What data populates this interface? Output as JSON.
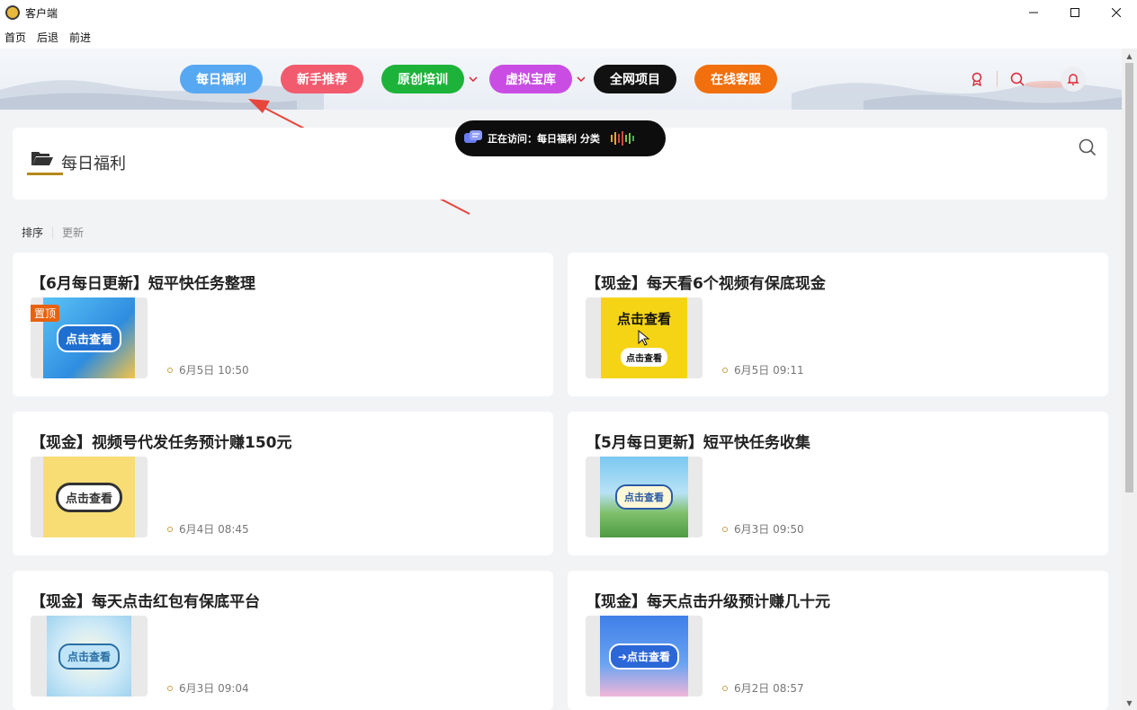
{
  "window": {
    "title": "客户端"
  },
  "menu": {
    "items": [
      "首页",
      "后退",
      "前进"
    ]
  },
  "nav": {
    "items": [
      {
        "label": "每日福利",
        "color": "#57a8f2",
        "dropdown": false
      },
      {
        "label": "新手推荐",
        "color": "#f25a6e",
        "dropdown": false
      },
      {
        "label": "原创培训",
        "color": "#1db33a",
        "dropdown": true
      },
      {
        "label": "虚拟宝库",
        "color": "#c94de3",
        "dropdown": true
      },
      {
        "label": "全网项目",
        "color": "#111111",
        "dropdown": false
      },
      {
        "label": "在线客服",
        "color": "#f26f0d",
        "dropdown": false
      }
    ]
  },
  "visiting": {
    "text": "正在访问：每日福利 分类"
  },
  "category": {
    "title": "每日福利"
  },
  "sort": {
    "label": "排序",
    "option": "更新"
  },
  "cards": [
    {
      "title": "【6月每日更新】短平快任务整理",
      "date": "6月5日 10:50",
      "pinned": true,
      "pin_label": "置顶",
      "thumb_label": "点击查看"
    },
    {
      "title": "【现金】每天看6个视频有保底现金",
      "date": "6月5日 09:11",
      "pinned": false,
      "thumb_label": "点击查看"
    },
    {
      "title": "【现金】视频号代发任务预计赚150元",
      "date": "6月4日 08:45",
      "pinned": false,
      "thumb_label": "点击查看"
    },
    {
      "title": "【5月每日更新】短平快任务收集",
      "date": "6月3日 09:50",
      "pinned": false,
      "thumb_label": "点击查看"
    },
    {
      "title": "【现金】每天点击红包有保底平台",
      "date": "6月3日 09:04",
      "pinned": false,
      "thumb_label": "点击查看"
    },
    {
      "title": "【现金】每天点击升级预计赚几十元",
      "date": "6月2日 08:57",
      "pinned": false,
      "thumb_label": "➔点击查看"
    }
  ]
}
